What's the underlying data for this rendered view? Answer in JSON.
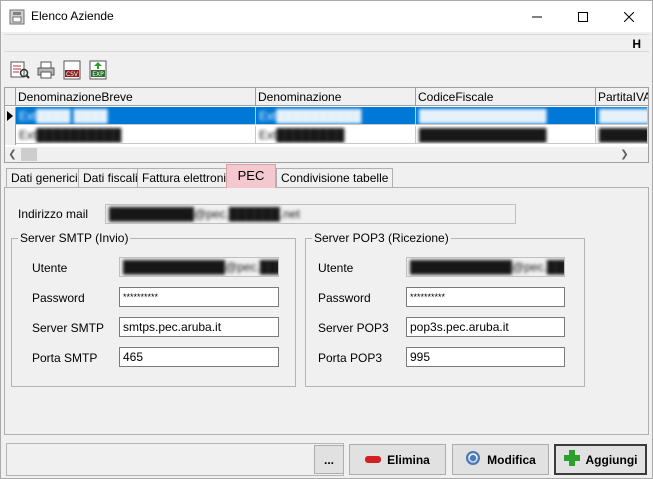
{
  "window": {
    "title": "Elenco Aziende"
  },
  "hstrip": {
    "label": "H"
  },
  "grid": {
    "columns": [
      "DenominazioneBreve",
      "Denominazione",
      "CodiceFiscale",
      "PartitaIVA"
    ],
    "rows": [
      [
        "Ext████ ████",
        "Ext██████████",
        "███████████████",
        "██████"
      ],
      [
        "Ext██████████",
        "Ext████████",
        "███████████████",
        "██████"
      ]
    ]
  },
  "tabs": [
    "Dati generici",
    "Dati fiscali",
    "Fattura elettronica",
    "PEC",
    "Condivisione tabelle"
  ],
  "pec": {
    "mail_label": "Indirizzo mail",
    "mail_value": "██████████@pec.██████.net",
    "smtp": {
      "title": "Server SMTP (Invio)",
      "user_label": "Utente",
      "user_value": "████████████@pec.██████",
      "password_label": "Password",
      "password_value": "**********",
      "server_label": "Server SMTP",
      "server_value": "smtps.pec.aruba.it",
      "port_label": "Porta SMTP",
      "port_value": "465"
    },
    "pop3": {
      "title": "Server POP3 (Ricezione)",
      "user_label": "Utente",
      "user_value": "████████████@pec.██████",
      "password_label": "Password",
      "password_value": "**********",
      "server_label": "Server POP3",
      "server_value": "pop3s.pec.aruba.it",
      "port_label": "Porta POP3",
      "port_value": "995"
    }
  },
  "buttons": {
    "dots": "...",
    "elimina": "Elimina",
    "modifica": "Modifica",
    "aggiungi": "Aggiungi"
  },
  "colors": {
    "selection": "#0078d7",
    "active_tab": "#f3c9cf",
    "delete_icon": "#d42020",
    "add_icon": "#2e9e2e"
  }
}
